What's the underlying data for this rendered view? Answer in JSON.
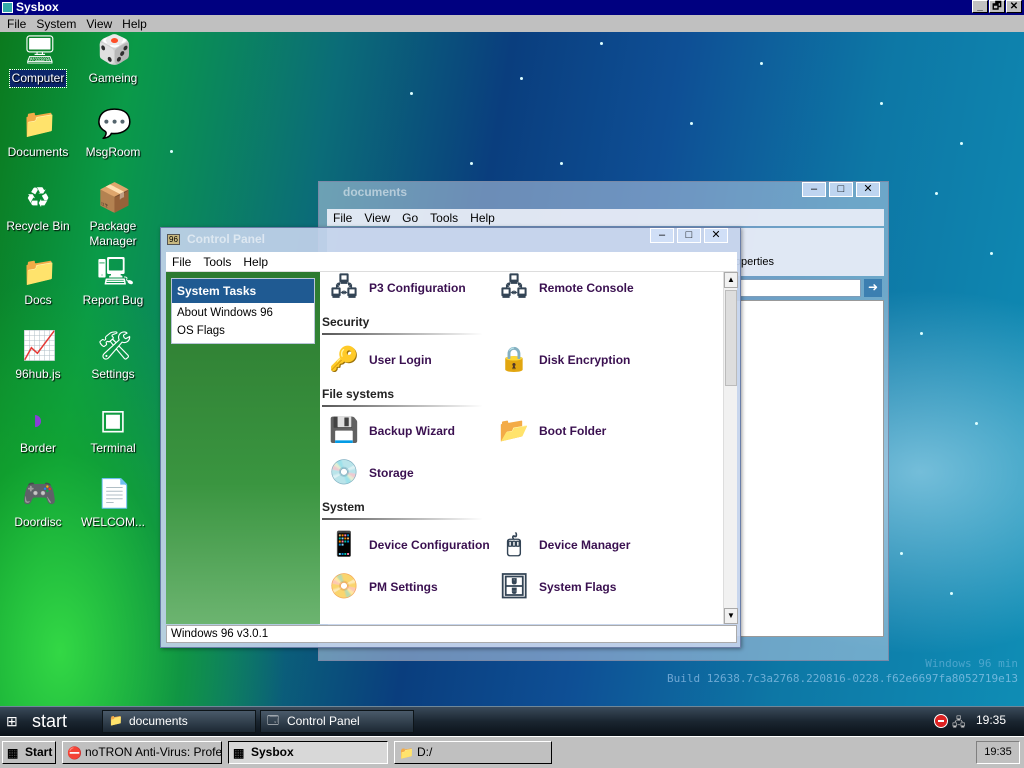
{
  "host": {
    "title": "Sysbox",
    "menu": [
      "File",
      "System",
      "View",
      "Help"
    ],
    "controls": [
      "_",
      "🗗",
      "✕"
    ]
  },
  "desktop": {
    "icons": [
      {
        "label": "Computer",
        "glyph": "🖥"
      },
      {
        "label": "Gameing",
        "glyph": "🎲"
      },
      {
        "label": "Documents",
        "glyph": "📁"
      },
      {
        "label": "MsgRoom",
        "glyph": "💬"
      },
      {
        "label": "Recycle Bin",
        "glyph": "♻"
      },
      {
        "label": "Package Manager",
        "glyph": "📦"
      },
      {
        "label": "Docs",
        "glyph": "📁"
      },
      {
        "label": "Report Bug",
        "glyph": "🖳"
      },
      {
        "label": "96hub.js",
        "glyph": "📈"
      },
      {
        "label": "Settings",
        "glyph": "🛠"
      },
      {
        "label": "Border",
        "glyph": "◗"
      },
      {
        "label": "Terminal",
        "glyph": "▣"
      },
      {
        "label": "Doordisc",
        "glyph": "🎮"
      },
      {
        "label": "WELCOM...",
        "glyph": "📄"
      }
    ],
    "watermark_line1": "Windows 96 min",
    "watermark_line2": "Build 12638.7c3a2768.220816-0228.f62e6697fa8052719e13"
  },
  "documents_window": {
    "title": "documents",
    "menu": [
      "File",
      "View",
      "Go",
      "Tools",
      "Help"
    ],
    "toolbar_label": "Properties",
    "controls": [
      "–",
      "□",
      "✕"
    ]
  },
  "control_panel": {
    "title": "Control Panel",
    "menu": [
      "File",
      "Tools",
      "Help"
    ],
    "controls": [
      "–",
      "□",
      "✕"
    ],
    "tasks_header": "System Tasks",
    "tasks": [
      "About Windows 96",
      "OS Flags"
    ],
    "sections": {
      "security": "Security",
      "file_systems": "File systems",
      "system": "System"
    },
    "items": {
      "p3_config": {
        "label": "P3 Configuration",
        "glyph": "🖧"
      },
      "remote_console": {
        "label": "Remote Console",
        "glyph": "🖧"
      },
      "user_login": {
        "label": "User Login",
        "glyph": "🔑"
      },
      "disk_encryption": {
        "label": "Disk Encryption",
        "glyph": "🔒"
      },
      "backup_wizard": {
        "label": "Backup Wizard",
        "glyph": "💾"
      },
      "boot_folder": {
        "label": "Boot Folder",
        "glyph": "📂"
      },
      "storage": {
        "label": "Storage",
        "glyph": "💿"
      },
      "device_configuration": {
        "label": "Device Configuration",
        "glyph": "📱"
      },
      "device_manager": {
        "label": "Device Manager",
        "glyph": "🖱"
      },
      "pm_settings": {
        "label": "PM Settings",
        "glyph": "📀"
      },
      "system_flags": {
        "label": "System Flags",
        "glyph": "🗄"
      }
    },
    "status": "Windows 96 v3.0.1"
  },
  "vista_taskbar": {
    "start_label": "start",
    "buttons": [
      {
        "label": "documents",
        "glyph": "📁"
      },
      {
        "label": "Control Panel",
        "glyph": "🗔"
      }
    ],
    "clock": "19:35"
  },
  "host_taskbar": {
    "start_label": "Start",
    "buttons": [
      {
        "label": "noTRON Anti-Virus: Profes...",
        "glyph": "⛔"
      },
      {
        "label": "Sysbox",
        "glyph": "▦"
      },
      {
        "label": "D:/",
        "glyph": "📁"
      }
    ],
    "clock": "19:35"
  }
}
